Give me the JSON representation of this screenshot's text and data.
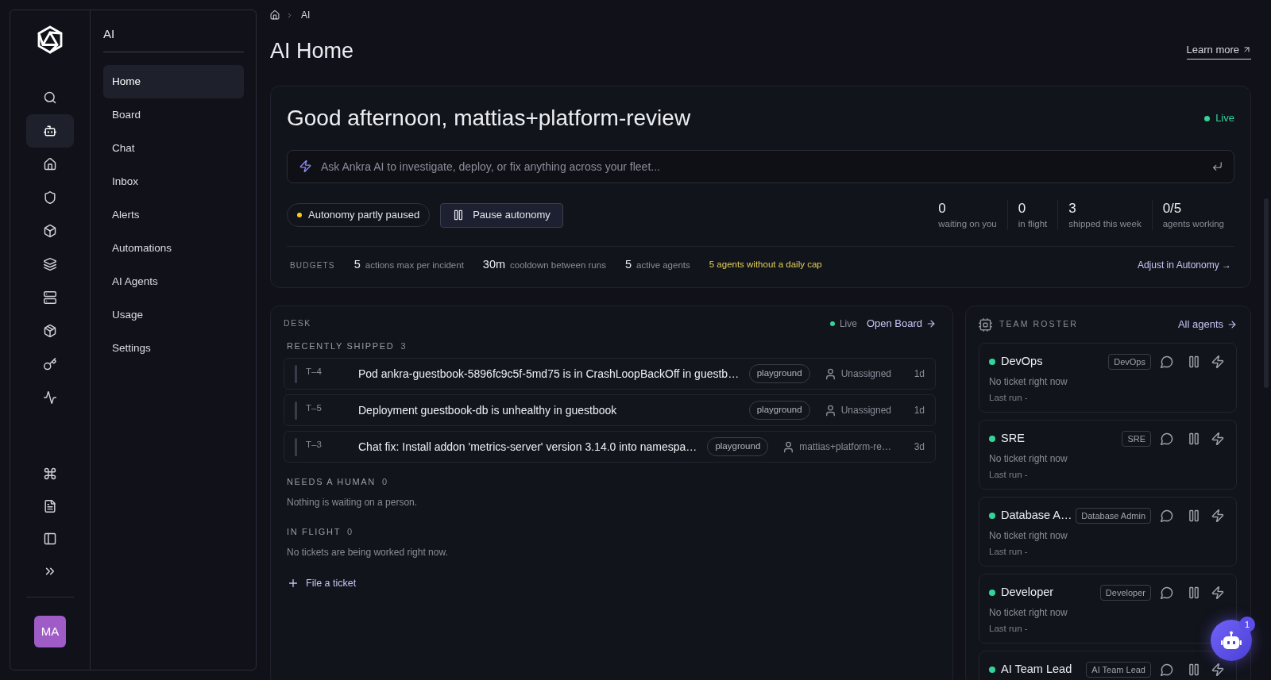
{
  "rail": {
    "items": [
      {
        "selected": false
      },
      {
        "selected": true
      },
      {
        "selected": false
      },
      {
        "selected": false
      },
      {
        "selected": false
      },
      {
        "selected": false
      },
      {
        "selected": false
      },
      {
        "selected": false
      },
      {
        "selected": false
      },
      {
        "selected": false
      }
    ],
    "avatar": {
      "initials": "MA"
    }
  },
  "nav": {
    "title": "AI",
    "items": [
      {
        "label": "Home",
        "selected": true
      },
      {
        "label": "Board",
        "selected": false
      },
      {
        "label": "Chat",
        "selected": false
      },
      {
        "label": "Inbox",
        "selected": false
      },
      {
        "label": "Alerts",
        "selected": false
      },
      {
        "label": "Automations",
        "selected": false
      },
      {
        "label": "AI Agents",
        "selected": false
      },
      {
        "label": "Usage",
        "selected": false
      },
      {
        "label": "Settings",
        "selected": false
      }
    ]
  },
  "breadcrumb": {
    "current": "AI"
  },
  "header": {
    "title": "AI Home",
    "learn_more": "Learn more"
  },
  "greeting": {
    "title": "Good afternoon, mattias+platform-review",
    "status": "Live",
    "prompt": {
      "placeholder": "Ask Ankra AI to investigate, deploy, or fix anything across your fleet..."
    },
    "autonomy": {
      "label": "Autonomy partly paused",
      "partly_paused": true
    },
    "pause_button": "Pause autonomy",
    "stats": [
      {
        "value": "0",
        "label": "waiting on you"
      },
      {
        "value": "0",
        "label": "in flight"
      },
      {
        "value": "3",
        "label": "shipped this week"
      },
      {
        "value": "0/5",
        "label": "agents working"
      }
    ],
    "budgets": {
      "label": "BUDGETS",
      "items": [
        {
          "value": "5",
          "label": "actions max per incident"
        },
        {
          "value": "30m",
          "label": "cooldown between runs"
        },
        {
          "value": "5",
          "label": "active agents"
        }
      ],
      "warning": "5 agents without a daily cap",
      "adjust_link": "Adjust in Autonomy →"
    }
  },
  "desk": {
    "title": "DESK",
    "status": "Live",
    "open_board": "Open Board",
    "sections": [
      {
        "title": "RECENTLY SHIPPED",
        "count": "3",
        "tickets": [
          {
            "id": "T–4",
            "title": "Pod ankra-guestbook-5896fc9c5f-5md75 is in CrashLoopBackOff in guestb…",
            "tag": "playground",
            "assignee": "Unassigned",
            "age": "1d"
          },
          {
            "id": "T–5",
            "title": "Deployment guestbook-db is unhealthy in guestbook",
            "tag": "playground",
            "assignee": "Unassigned",
            "age": "1d"
          },
          {
            "id": "T–3",
            "title": "Chat fix: Install addon 'metrics-server' version 3.14.0 into namespa…",
            "tag": "playground",
            "assignee": "mattias+platform-re…",
            "age": "3d"
          }
        ]
      },
      {
        "title": "NEEDS A HUMAN",
        "count": "0",
        "empty": "Nothing is waiting on a person."
      },
      {
        "title": "IN FLIGHT",
        "count": "0",
        "empty": "No tickets are being worked right now."
      }
    ],
    "file_ticket": "File a ticket"
  },
  "roster": {
    "title": "TEAM ROSTER",
    "all_link": "All agents",
    "agents": [
      {
        "name": "DevOps",
        "tag": "DevOps",
        "online": true,
        "status_text": "No ticket right now",
        "last_run": "Last run -"
      },
      {
        "name": "SRE",
        "tag": "SRE",
        "online": true,
        "status_text": "No ticket right now",
        "last_run": "Last run -"
      },
      {
        "name": "Database A…",
        "tag": "Database Admin",
        "online": true,
        "status_text": "No ticket right now",
        "last_run": "Last run -"
      },
      {
        "name": "Developer",
        "tag": "Developer",
        "online": true,
        "status_text": "No ticket right now",
        "last_run": "Last run -"
      },
      {
        "name": "AI Team Lead",
        "tag": "AI Team Lead",
        "online": true
      }
    ]
  },
  "assistant_button": {
    "badge": "1"
  }
}
